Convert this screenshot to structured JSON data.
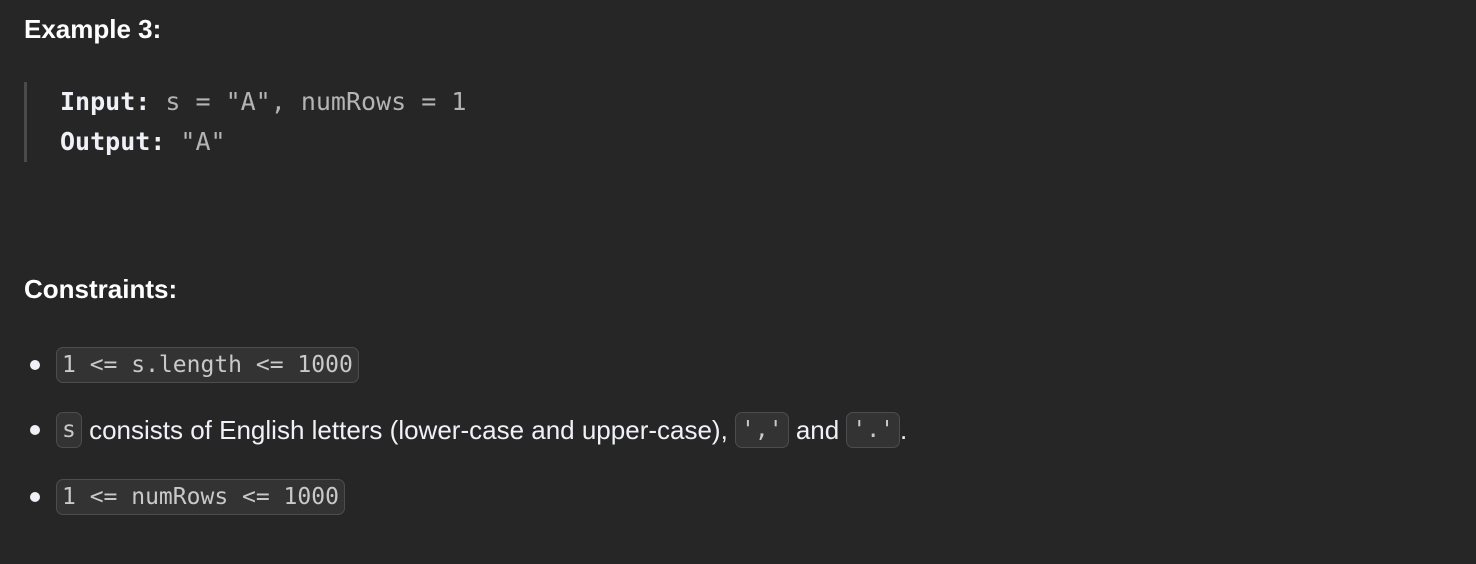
{
  "example": {
    "heading": "Example 3:",
    "input_label": "Input:",
    "input_value": " s = \"A\", numRows = 1",
    "output_label": "Output:",
    "output_value": " \"A\""
  },
  "constraints": {
    "heading": "Constraints:",
    "items": [
      {
        "code": "1 <= s.length <= 1000"
      },
      {
        "code_s": "s",
        "text1": " consists of English letters (lower-case and upper-case), ",
        "code_comma": "','",
        "text2": " and ",
        "code_dot": "'.'",
        "text3": "."
      },
      {
        "code": "1 <= numRows <= 1000"
      }
    ]
  }
}
